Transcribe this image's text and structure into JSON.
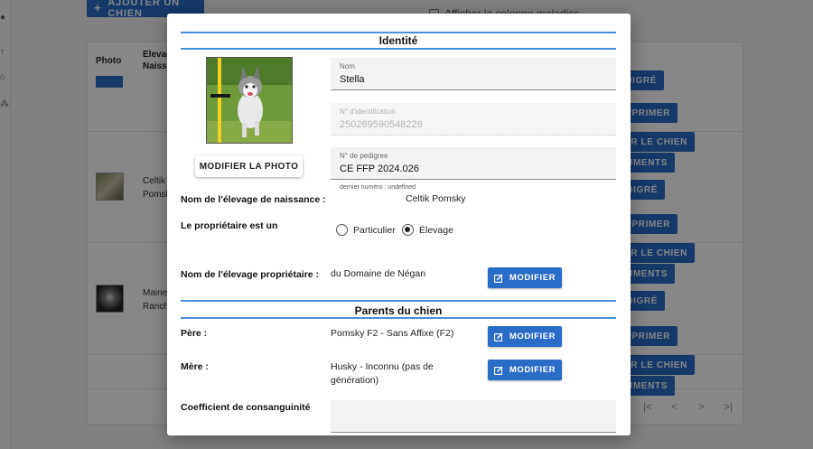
{
  "background": {
    "add_button": "AJOUTER UN CHIEN",
    "checkbox_label": "Afficher la colonne maladies",
    "columns": [
      "Photo",
      "Elevag",
      "Naissa"
    ],
    "rows": [
      {
        "line1": "Celtik",
        "line2": "Pomsk"
      },
      {
        "line1": "Maine",
        "line2": "Ranch"
      }
    ],
    "side_buttons": [
      "DIGRÉ",
      "PPRIMER",
      "ER LE CHIEN",
      "UMENTS",
      "DIGRÉ",
      "PPRIMER",
      "ER LE CHIEN",
      "UMENTS",
      "DIGRÉ",
      "PPRIMER",
      "ER LE CHIEN",
      "UMENTS"
    ],
    "pagination": [
      "|<",
      "<",
      ">",
      ">|"
    ]
  },
  "modal": {
    "identity_title": "Identité",
    "photo_button": "MODIFIER LA PHOTO",
    "name_field": {
      "label": "Nom",
      "value": "Stella"
    },
    "id_field": {
      "label": "N° d'identification",
      "value": "250269590548228"
    },
    "pedigree_field": {
      "label": "N° de pedigree",
      "value": "CE FFP 2024.026"
    },
    "pedigree_helper": "dernier numéro : undefined",
    "birth_kennel_label": "Nom de l'élevage de naissance :",
    "birth_kennel_value": "Celtik Pomsky",
    "owner_type_label": "Le propriétaire est un",
    "owner_type_options": [
      {
        "label": "Particulier",
        "selected": false
      },
      {
        "label": "Élevage",
        "selected": true
      }
    ],
    "owner_kennel_label": "Nom de l'élevage propriétaire :",
    "owner_kennel_value": "du Domaine de Négan",
    "modify_label": "MODIFIER",
    "parents_title": "Parents du chien",
    "father_label": "Père :",
    "father_value": "Pomsky F2 - Sans Affixe (F2)",
    "mother_label": "Mère :",
    "mother_value_1": "Husky - Inconnu (pas de",
    "mother_value_2": "génération)",
    "coef_label": "Coefficient de consanguinité",
    "accent_color": "#2a6dc6",
    "divider_color": "#4a90d9"
  }
}
